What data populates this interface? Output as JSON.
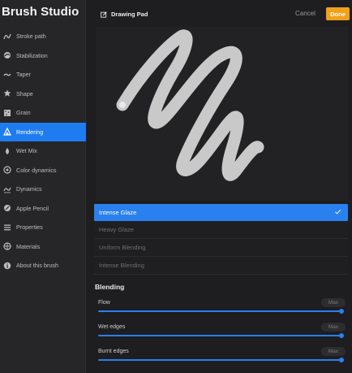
{
  "app": {
    "title": "Brush Studio"
  },
  "sidebar": {
    "items": [
      {
        "label": "Stroke path",
        "icon": "stroke-path-icon"
      },
      {
        "label": "Stabilization",
        "icon": "stabilization-icon"
      },
      {
        "label": "Taper",
        "icon": "taper-icon"
      },
      {
        "label": "Shape",
        "icon": "shape-icon"
      },
      {
        "label": "Grain",
        "icon": "grain-icon"
      },
      {
        "label": "Rendering",
        "icon": "rendering-icon",
        "active": true
      },
      {
        "label": "Wet Mix",
        "icon": "wet-mix-icon"
      },
      {
        "label": "Color dynamics",
        "icon": "color-dynamics-icon"
      },
      {
        "label": "Dynamics",
        "icon": "dynamics-icon"
      },
      {
        "label": "Apple Pencil",
        "icon": "apple-pencil-icon"
      },
      {
        "label": "Properties",
        "icon": "properties-icon"
      },
      {
        "label": "Materials",
        "icon": "materials-icon"
      },
      {
        "label": "About this brush",
        "icon": "info-icon"
      }
    ]
  },
  "topbar": {
    "pad_title": "Drawing Pad",
    "cancel_label": "Cancel",
    "done_label": "Done"
  },
  "rendering_modes": {
    "selected": "Intense Glaze",
    "options": [
      "Intense Glaze",
      "Heavy Glaze",
      "Uniform Blending",
      "Intense Blending"
    ]
  },
  "blending": {
    "title": "Blending",
    "sliders": [
      {
        "label": "Flow",
        "value_text": "Max",
        "value": 1.0
      },
      {
        "label": "Wet edges",
        "value_text": "Max",
        "value": 1.0
      },
      {
        "label": "Burnt edges",
        "value_text": "Max",
        "value": 1.0
      }
    ]
  },
  "colors": {
    "accent": "#2a80ee",
    "done": "#f0a11a",
    "stroke": "#c8c8c8"
  }
}
